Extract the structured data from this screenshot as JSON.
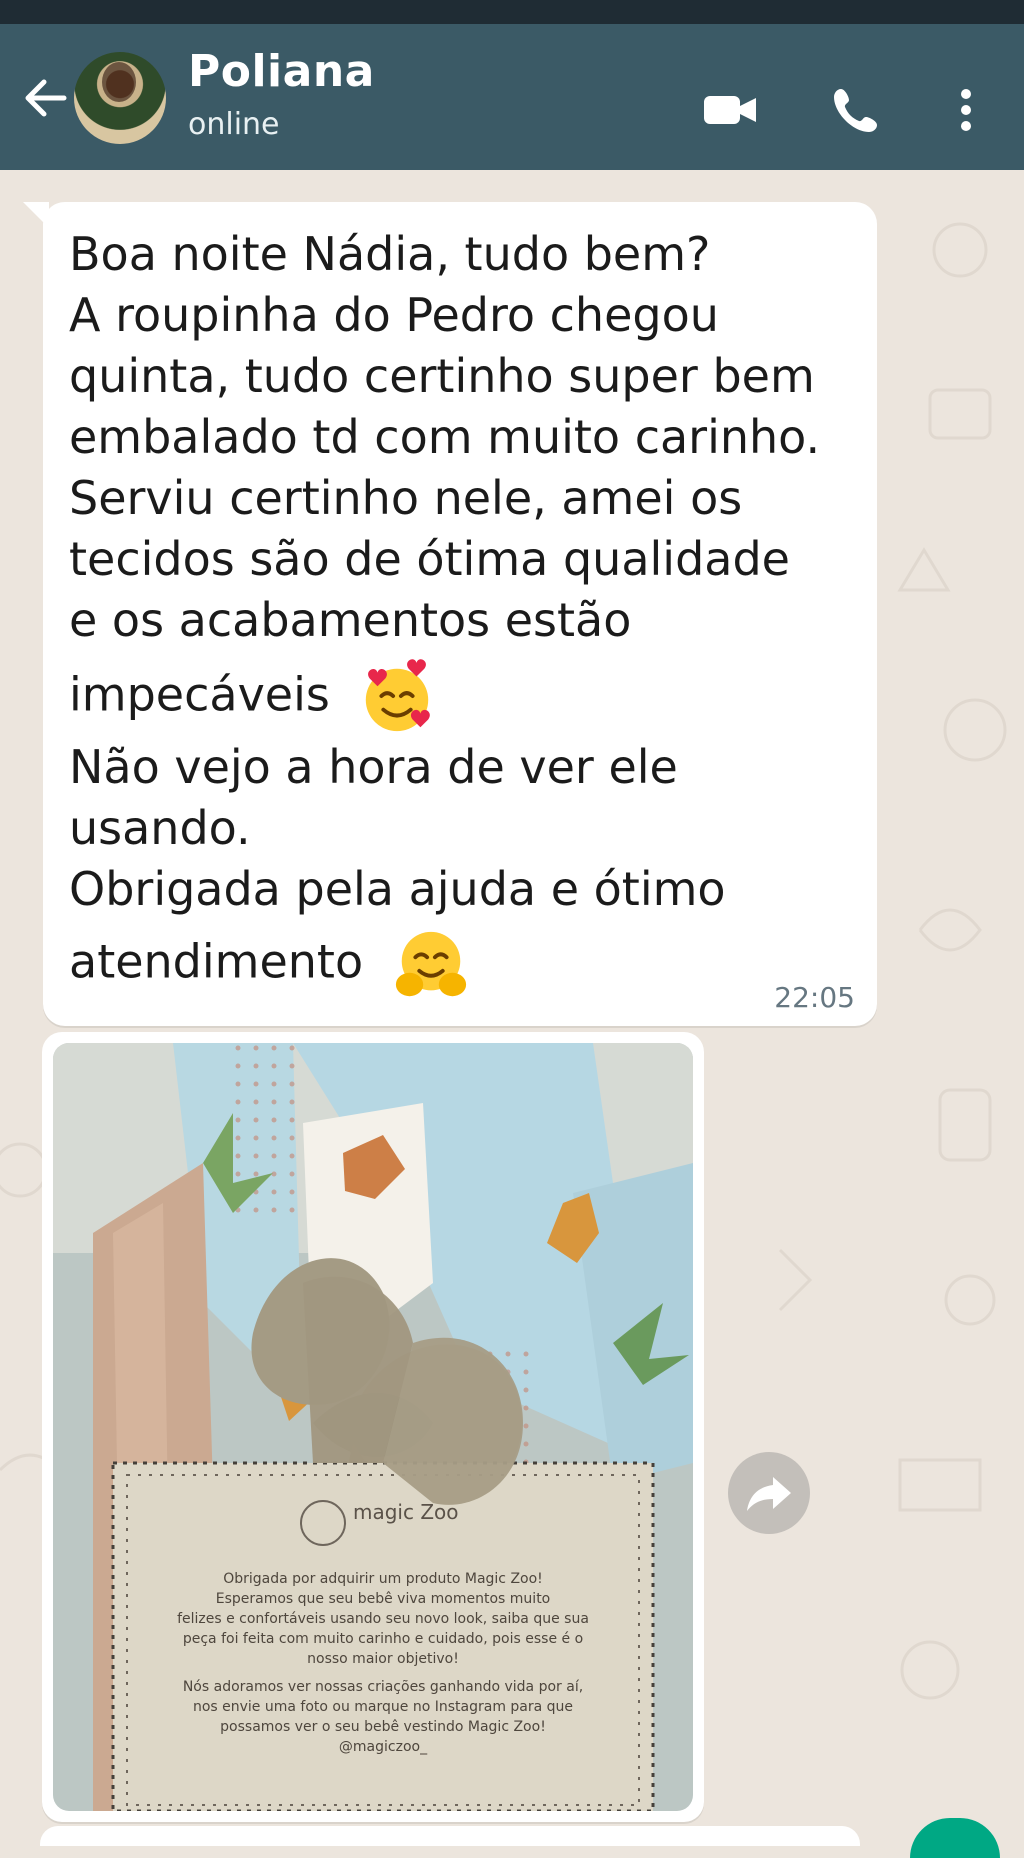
{
  "header": {
    "contact_name": "Poliana",
    "contact_status": "online",
    "icons": {
      "back": "back-arrow-icon",
      "video": "video-call-icon",
      "call": "voice-call-icon",
      "menu": "more-options-icon"
    }
  },
  "messages": [
    {
      "lines": [
        "Boa noite Nádia, tudo bem?",
        "A roupinha do Pedro chegou",
        "quinta, tudo certinho super bem",
        "embalado td com muito carinho.",
        "Serviu certinho nele, amei os",
        "tecidos são de ótima qualidade",
        "e os acabamentos estão",
        "impecáveis",
        "Não vejo a hora de ver ele",
        "usando.",
        "Obrigada pela ajuda e ótimo",
        "atendimento"
      ],
      "time": "22:05"
    }
  ],
  "photo_message": {
    "card_brand": "magic Zoo",
    "card_text": [
      "Obrigada por adquirir um produto Magic Zoo!",
      "Esperamos que seu bebê viva momentos muito",
      "felizes e confortáveis usando seu novo look, saiba que sua",
      "peça foi feita com muito carinho e cuidado, pois esse é o",
      "nosso maior objetivo!",
      "Nós adoramos ver nossas criações ganhando vida por aí,",
      "nos envie uma foto ou marque no Instagram para que",
      "possamos ver o seu bebê vestindo Magic Zoo!",
      "@magiczoo_"
    ]
  },
  "colors": {
    "header": "#3b5a66",
    "chat_bg": "#ece5dd",
    "bubble": "#ffffff",
    "timestamp": "#667781"
  }
}
